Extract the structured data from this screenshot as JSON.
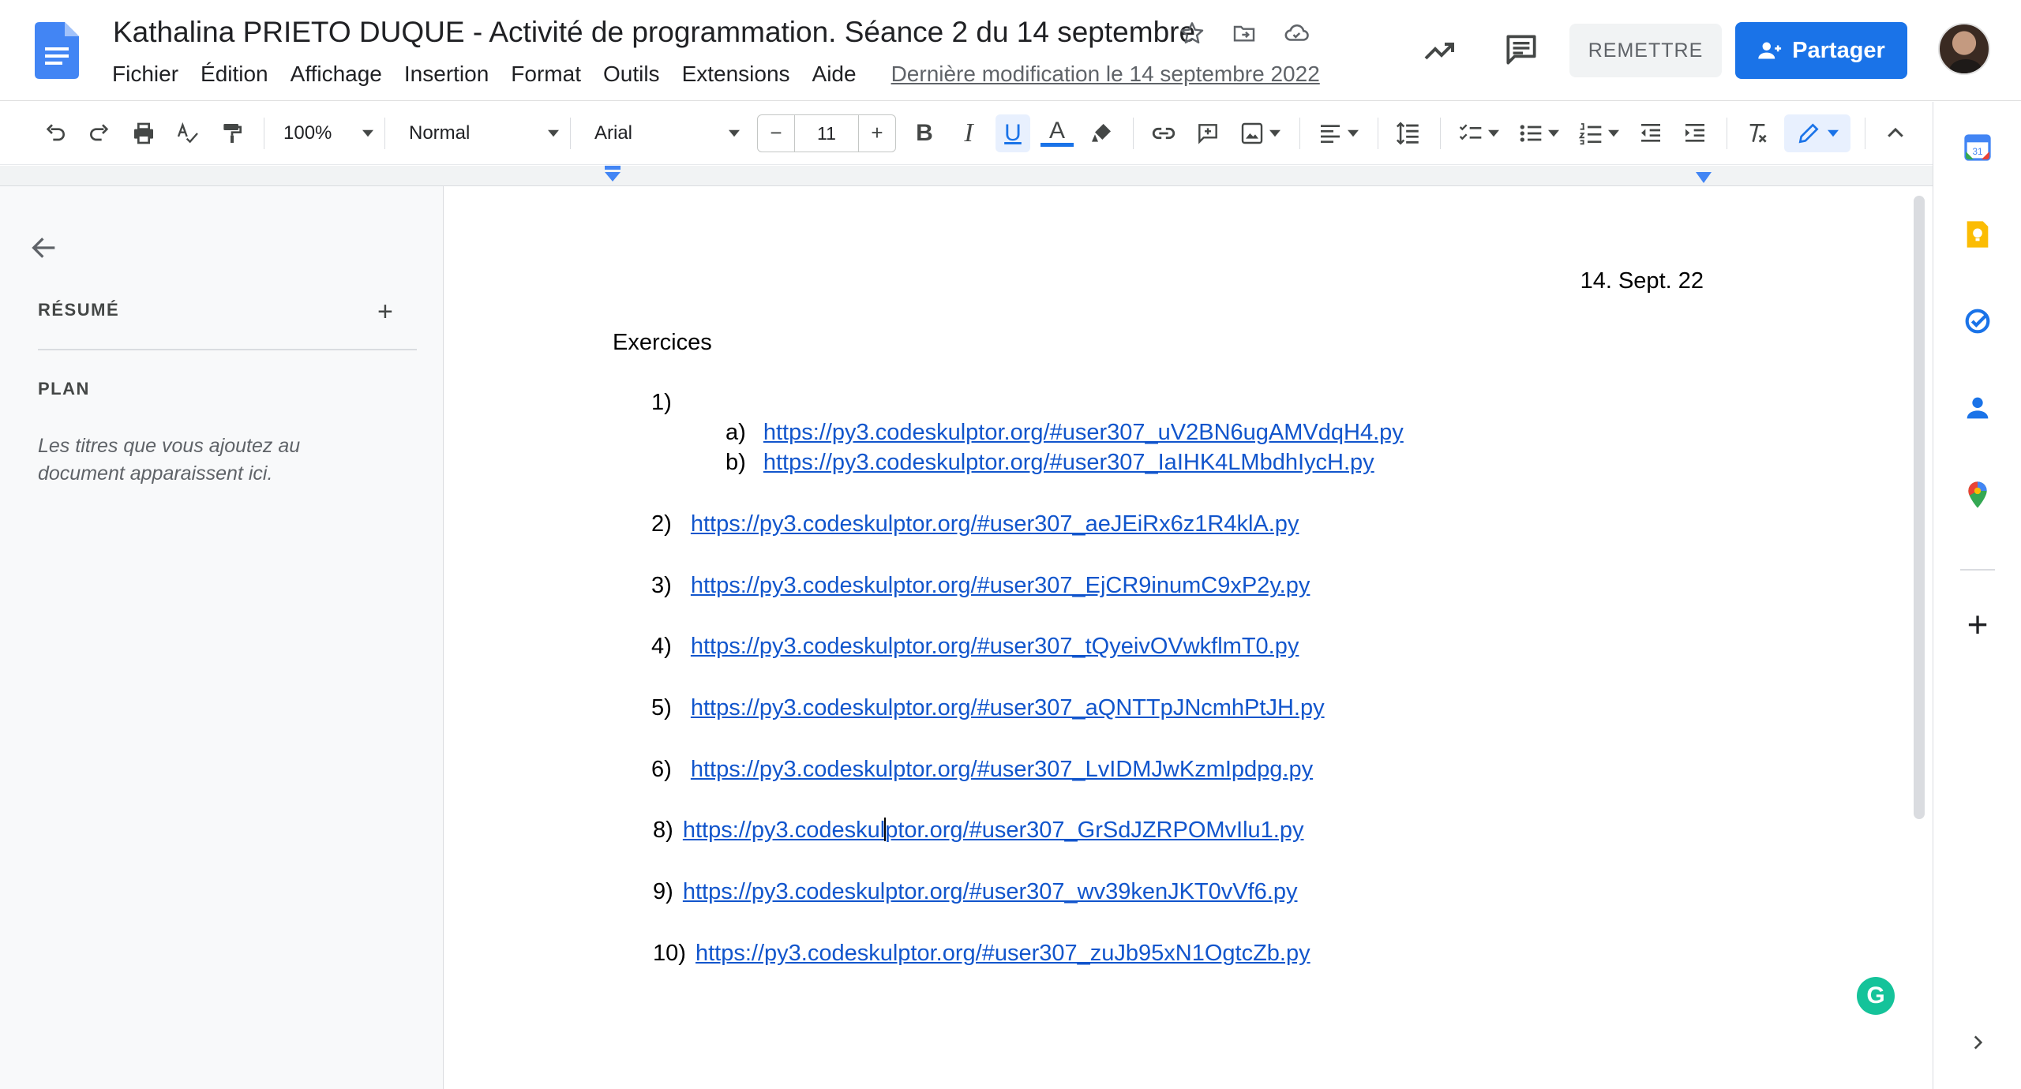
{
  "header": {
    "title": "Kathalina PRIETO DUQUE - Activité de programmation. Séance 2 du 14 septembre",
    "menu": [
      "Fichier",
      "Édition",
      "Affichage",
      "Insertion",
      "Format",
      "Outils",
      "Extensions",
      "Aide"
    ],
    "last_edit": "Dernière modification le 14 septembre 2022",
    "remettre_label": "REMETTRE",
    "share_label": "Partager"
  },
  "toolbar": {
    "zoom": "100%",
    "style": "Normal",
    "font": "Arial",
    "font_size": "11"
  },
  "left_panel": {
    "resume_label": "RÉSUMÉ",
    "plan_label": "PLAN",
    "plan_hint": "Les titres que vous ajoutez au document apparaissent ici."
  },
  "document": {
    "date": "14. Sept. 22",
    "heading": "Exercices",
    "items": [
      {
        "num": "1)"
      },
      {
        "num": "a)",
        "link": "https://py3.codeskulptor.org/#user307_uV2BN6ugAMVdqH4.py"
      },
      {
        "num": "b)",
        "link": "https://py3.codeskulptor.org/#user307_IaIHK4LMbdhIycH.py"
      },
      {
        "num": "2)",
        "link": "https://py3.codeskulptor.org/#user307_aeJEiRx6z1R4klA.py"
      },
      {
        "num": "3)",
        "link": "https://py3.codeskulptor.org/#user307_EjCR9inumC9xP2y.py"
      },
      {
        "num": "4)",
        "link": "https://py3.codeskulptor.org/#user307_tQyeivOVwkflmT0.py"
      },
      {
        "num": "5)",
        "link": "https://py3.codeskulptor.org/#user307_aQNTTpJNcmhPtJH.py"
      },
      {
        "num": "6)",
        "link": "https://py3.codeskulptor.org/#user307_LvIDMJwKzmIpdpg.py"
      },
      {
        "num": "8)",
        "link_a": "https://py3.codeskul",
        "link_b": "ptor.org/#user307_GrSdJZRPOMvIlu1.py"
      },
      {
        "num": "9)",
        "link": "https://py3.codeskulptor.org/#user307_wv39kenJKT0vVf6.py"
      },
      {
        "num": "10)",
        "link": "https://py3.codeskulptor.org/#user307_zuJb95xN1OgtcZb.py"
      }
    ]
  },
  "colors": {
    "accent": "#1a73e8",
    "link": "#1155cc",
    "grammarly": "#15c39a"
  }
}
